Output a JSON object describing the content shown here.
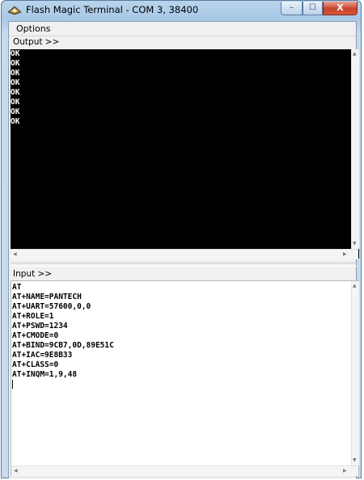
{
  "window": {
    "title": "Flash Magic Terminal - COM 3, 38400"
  },
  "menu": {
    "options_label": "Options"
  },
  "output": {
    "label": "Output >>",
    "text": "OK\nOK\nOK\nOK\nOK\nOK\nOK\nOK"
  },
  "input": {
    "label": "Input >>",
    "text": "AT\nAT+NAME=PANTECH\nAT+UART=57600,0,0\nAT+ROLE=1\nAT+PSWD=1234\nAT+CMODE=0\nAT+BIND=9CB7,0D,89E51C\nAT+IAC=9E8B33\nAT+CLASS=0\nAT+INQM=1,9,48"
  },
  "icons": {
    "app": "terminal-app-icon",
    "minimize": "minimize-icon",
    "maximize": "maximize-icon",
    "close": "close-icon"
  },
  "glyphs": {
    "min": "–",
    "max": "☐",
    "close": "X",
    "up": "▲",
    "down": "▼",
    "left": "◀",
    "right": "▶"
  },
  "colors": {
    "output_bg": "#000000",
    "output_fg": "#ffffff",
    "input_bg": "#ffffff",
    "close_button": "#c8432b"
  }
}
